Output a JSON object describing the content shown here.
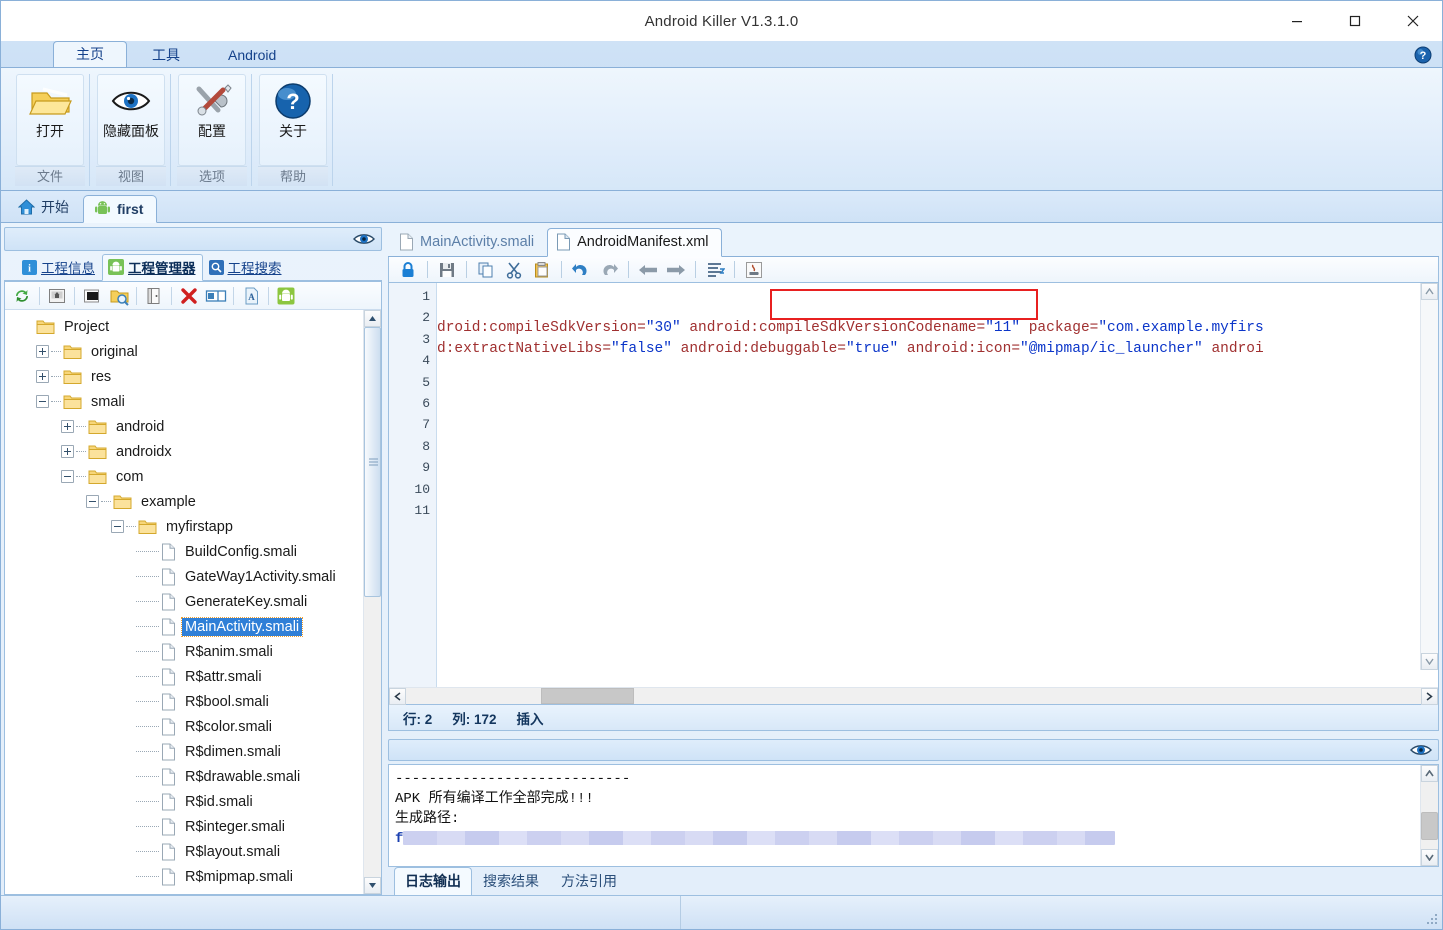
{
  "window": {
    "title": "Android Killer V1.3.1.0",
    "minimize_label": "minimize",
    "maximize_label": "maximize",
    "close_label": "close"
  },
  "ribbon": {
    "tabs": [
      {
        "label": "主页",
        "active": true
      },
      {
        "label": "工具",
        "active": false
      },
      {
        "label": "Android",
        "active": false
      }
    ],
    "help_icon": "help-icon",
    "groups": [
      {
        "title": "文件",
        "buttons": [
          {
            "label": "打开",
            "icon": "open-folder-icon"
          }
        ]
      },
      {
        "title": "视图",
        "buttons": [
          {
            "label": "隐藏面板",
            "icon": "eye-icon"
          }
        ]
      },
      {
        "title": "选项",
        "buttons": [
          {
            "label": "配置",
            "icon": "tools-icon"
          }
        ]
      },
      {
        "title": "帮助",
        "buttons": [
          {
            "label": "关于",
            "icon": "question-icon"
          }
        ]
      }
    ]
  },
  "project_tabs": [
    {
      "label": "开始",
      "icon": "home-icon",
      "active": false
    },
    {
      "label": "first",
      "icon": "android-icon",
      "active": true
    }
  ],
  "left_panel": {
    "eye_icon": "eye-icon",
    "tabs": [
      {
        "label": "工程信息",
        "icon": "info-icon",
        "active": false
      },
      {
        "label": "工程管理器",
        "icon": "android-icon",
        "active": true
      },
      {
        "label": "工程搜索",
        "icon": "search-icon",
        "active": false
      }
    ],
    "toolbar": [
      {
        "name": "refresh-icon"
      },
      {
        "name": "export-icon"
      },
      {
        "name": "screen-icon"
      },
      {
        "name": "folder-search-icon"
      },
      {
        "name": "book-icon"
      },
      {
        "name": "delete-icon"
      },
      {
        "name": "rename-icon"
      },
      {
        "name": "text-file-icon"
      },
      {
        "name": "android-build-icon"
      }
    ],
    "tree": [
      {
        "label": "Project",
        "depth": 0,
        "type": "folder",
        "toggle": "none",
        "selected": false
      },
      {
        "label": "original",
        "depth": 1,
        "type": "folder",
        "toggle": "plus",
        "selected": false
      },
      {
        "label": "res",
        "depth": 1,
        "type": "folder",
        "toggle": "plus",
        "selected": false
      },
      {
        "label": "smali",
        "depth": 1,
        "type": "folder",
        "toggle": "minus",
        "selected": false
      },
      {
        "label": "android",
        "depth": 2,
        "type": "folder",
        "toggle": "plus",
        "selected": false
      },
      {
        "label": "androidx",
        "depth": 2,
        "type": "folder",
        "toggle": "plus",
        "selected": false
      },
      {
        "label": "com",
        "depth": 2,
        "type": "folder",
        "toggle": "minus",
        "selected": false
      },
      {
        "label": "example",
        "depth": 3,
        "type": "folder",
        "toggle": "minus",
        "selected": false
      },
      {
        "label": "myfirstapp",
        "depth": 4,
        "type": "folder",
        "toggle": "minus",
        "selected": false
      },
      {
        "label": "BuildConfig.smali",
        "depth": 5,
        "type": "file",
        "toggle": "none",
        "selected": false
      },
      {
        "label": "GateWay1Activity.smali",
        "depth": 5,
        "type": "file",
        "toggle": "none",
        "selected": false
      },
      {
        "label": "GenerateKey.smali",
        "depth": 5,
        "type": "file",
        "toggle": "none",
        "selected": false
      },
      {
        "label": "MainActivity.smali",
        "depth": 5,
        "type": "file",
        "toggle": "none",
        "selected": true
      },
      {
        "label": "R$anim.smali",
        "depth": 5,
        "type": "file",
        "toggle": "none",
        "selected": false
      },
      {
        "label": "R$attr.smali",
        "depth": 5,
        "type": "file",
        "toggle": "none",
        "selected": false
      },
      {
        "label": "R$bool.smali",
        "depth": 5,
        "type": "file",
        "toggle": "none",
        "selected": false
      },
      {
        "label": "R$color.smali",
        "depth": 5,
        "type": "file",
        "toggle": "none",
        "selected": false
      },
      {
        "label": "R$dimen.smali",
        "depth": 5,
        "type": "file",
        "toggle": "none",
        "selected": false
      },
      {
        "label": "R$drawable.smali",
        "depth": 5,
        "type": "file",
        "toggle": "none",
        "selected": false
      },
      {
        "label": "R$id.smali",
        "depth": 5,
        "type": "file",
        "toggle": "none",
        "selected": false
      },
      {
        "label": "R$integer.smali",
        "depth": 5,
        "type": "file",
        "toggle": "none",
        "selected": false
      },
      {
        "label": "R$layout.smali",
        "depth": 5,
        "type": "file",
        "toggle": "none",
        "selected": false
      },
      {
        "label": "R$mipmap.smali",
        "depth": 5,
        "type": "file",
        "toggle": "none",
        "selected": false
      }
    ]
  },
  "editor": {
    "tabs": [
      {
        "label": "MainActivity.smali",
        "icon": "file-icon",
        "active": false
      },
      {
        "label": "AndroidManifest.xml",
        "icon": "file-icon",
        "active": true
      }
    ],
    "toolbar": [
      {
        "name": "lock-icon"
      },
      {
        "name": "save-icon"
      },
      {
        "name": "copy-icon"
      },
      {
        "name": "cut-icon"
      },
      {
        "name": "paste-icon"
      },
      {
        "name": "undo-icon"
      },
      {
        "name": "redo-icon"
      },
      {
        "name": "back-arrow-icon"
      },
      {
        "name": "forward-arrow-icon"
      },
      {
        "name": "format-icon"
      },
      {
        "name": "java-icon"
      }
    ],
    "line_numbers": [
      "1",
      "2",
      "3",
      "4",
      "5",
      "6",
      "7",
      "8",
      "9",
      "10",
      "11"
    ],
    "lines": [
      {
        "n": 1,
        "parts": [
          {
            "t": "droid:compileSdkVersion=",
            "c": "attr"
          },
          {
            "t": "\"30\"",
            "c": "val"
          },
          {
            "t": " android:compileSdkVersionCodename=",
            "c": "attr"
          },
          {
            "t": "\"11\"",
            "c": "val"
          },
          {
            "t": " package=",
            "c": "attr"
          },
          {
            "t": "\"com.example.myfirs",
            "c": "val"
          }
        ]
      },
      {
        "n": 2,
        "parts": [
          {
            "t": "d:extractNativeLibs=",
            "c": "attr"
          },
          {
            "t": "\"false\"",
            "c": "val"
          },
          {
            "t": " android:debuggable=",
            "c": "attr"
          },
          {
            "t": "\"true\"",
            "c": "val"
          },
          {
            "t": " android:icon=",
            "c": "attr"
          },
          {
            "t": "\"@mipmap/ic_launcher\"",
            "c": "val"
          },
          {
            "t": " androi",
            "c": "attr"
          }
        ]
      }
    ],
    "highlight_color": "#e82020",
    "status": {
      "row_label": "行: 2",
      "col_label": "列: 172",
      "mode_label": "插入"
    }
  },
  "log_panel": {
    "eye_icon": "eye-icon",
    "lines": [
      "----------------------------",
      "APK 所有编译工作全部完成!!!",
      "生成路径:"
    ],
    "redacted_prefix": "f",
    "tabs": [
      {
        "label": "日志输出",
        "active": true
      },
      {
        "label": "搜索结果",
        "active": false
      },
      {
        "label": "方法引用",
        "active": false
      }
    ]
  },
  "statusbar": {
    "left_text": "",
    "right_text": ""
  }
}
